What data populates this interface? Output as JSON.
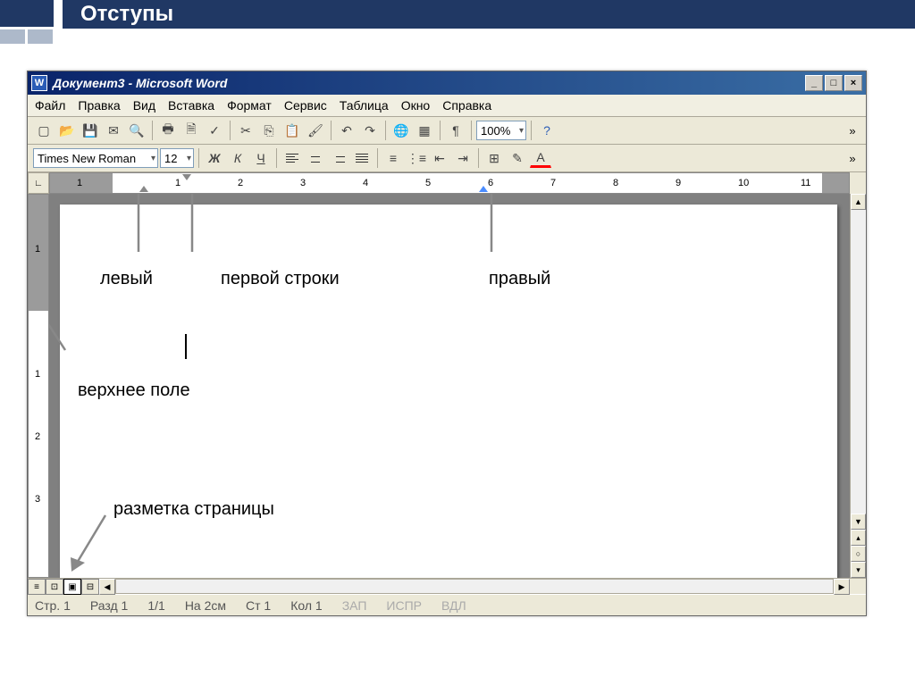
{
  "slide": {
    "title": "Отступы"
  },
  "window": {
    "title": "Документ3 - Microsoft Word",
    "minimize": "_",
    "maximize": "□",
    "close": "×"
  },
  "menu": {
    "file": "Файл",
    "edit": "Правка",
    "view": "Вид",
    "insert": "Вставка",
    "format": "Формат",
    "tools": "Сервис",
    "table": "Таблица",
    "window": "Окно",
    "help": "Справка"
  },
  "toolbar": {
    "zoom": "100%",
    "font": "Times New Roman",
    "fontsize": "12"
  },
  "ruler_numbers": [
    "1",
    "1",
    "2",
    "3",
    "4",
    "5",
    "6",
    "7",
    "8",
    "9",
    "10",
    "11"
  ],
  "annotations": {
    "left": "левый",
    "first_line": "первой строки",
    "right": "правый",
    "top_margin": "верхнее поле",
    "page_layout": "разметка страницы"
  },
  "statusbar": {
    "page": "Стр. 1",
    "sec": "Разд 1",
    "pages": "1/1",
    "at": "На 2см",
    "ln": "Ст 1",
    "col": "Кол 1",
    "rec": "ЗАП",
    "trk": "ИСПР",
    "ext": "ВДЛ"
  }
}
